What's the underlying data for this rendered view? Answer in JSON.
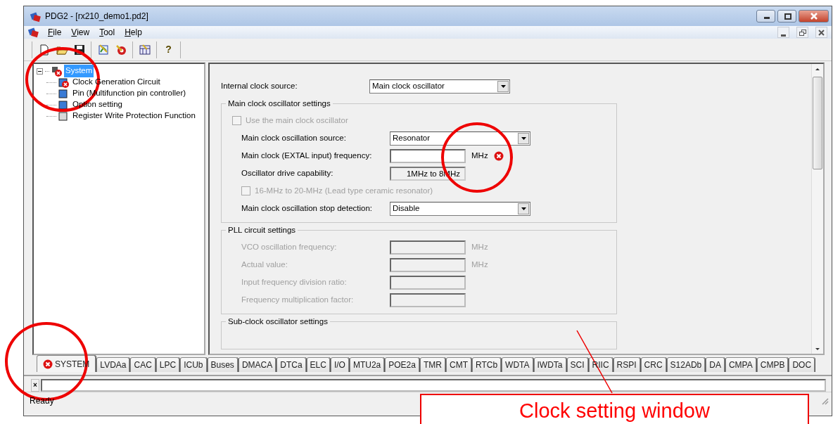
{
  "window": {
    "title": "PDG2 - [rx210_demo1.pd2]"
  },
  "menu": [
    {
      "label": "File"
    },
    {
      "label": "View"
    },
    {
      "label": "Tool"
    },
    {
      "label": "Help"
    }
  ],
  "toolbar": {
    "help_label": "?"
  },
  "tree": {
    "label": "System",
    "kind": "error",
    "selected": true,
    "expanded": true,
    "children": [
      {
        "label": "Clock Generation Circuit",
        "kind": "error",
        "selected": false
      },
      {
        "label": "Pin (Multifunction pin controller)",
        "kind": "ok",
        "selected": false
      },
      {
        "label": "Option setting",
        "kind": "ok",
        "selected": false
      },
      {
        "label": "Register Write Protection Function",
        "kind": "unused",
        "selected": false
      }
    ]
  },
  "form": {
    "internal_clock_source": {
      "label": "Internal clock source:",
      "value": "Main clock oscillator"
    },
    "groups": [
      {
        "title": "Main clock oscillator settings",
        "rows": [
          {
            "kind": "checkbox",
            "label": "Use the main clock oscillator",
            "checked": false,
            "disabled": true
          },
          {
            "kind": "select",
            "label": "Main clock oscillation source:",
            "value": "Resonator",
            "disabled": false
          },
          {
            "kind": "input",
            "label": "Main clock (EXTAL input) frequency:",
            "unit": "MHz",
            "error": true,
            "disabled": false
          },
          {
            "kind": "readout",
            "label": "Oscillator drive capability:",
            "value": "1MHz to 8MHz",
            "disabled": false
          },
          {
            "kind": "checkbox",
            "label": "16-MHz to 20-MHz (Lead type ceramic resonator)",
            "checked": false,
            "disabled": true
          },
          {
            "kind": "select",
            "label": "Main clock oscillation stop detection:",
            "value": "Disable",
            "disabled": false
          }
        ]
      },
      {
        "title": "PLL circuit settings",
        "rows": [
          {
            "kind": "input",
            "label": "VCO oscillation frequency:",
            "unit": "MHz",
            "error": false,
            "disabled": true
          },
          {
            "kind": "input",
            "label": "Actual value:",
            "unit": "MHz",
            "error": false,
            "disabled": true
          },
          {
            "kind": "input",
            "label": "Input frequency division ratio:",
            "error": false,
            "disabled": true
          },
          {
            "kind": "input",
            "label": "Frequency multiplication factor:",
            "error": false,
            "disabled": true
          }
        ]
      },
      {
        "title": "Sub-clock oscillator settings"
      }
    ]
  },
  "tabs": [
    {
      "label": "SYSTEM",
      "selected": true,
      "error": true
    },
    {
      "label": "LVDAa",
      "selected": false,
      "error": false
    },
    {
      "label": "CAC",
      "selected": false,
      "error": false
    },
    {
      "label": "LPC",
      "selected": false,
      "error": false
    },
    {
      "label": "ICUb",
      "selected": false,
      "error": false
    },
    {
      "label": "Buses",
      "selected": false,
      "error": false
    },
    {
      "label": "DMACA",
      "selected": false,
      "error": false
    },
    {
      "label": "DTCa",
      "selected": false,
      "error": false
    },
    {
      "label": "ELC",
      "selected": false,
      "error": false
    },
    {
      "label": "I/O",
      "selected": false,
      "error": false
    },
    {
      "label": "MTU2a",
      "selected": false,
      "error": false
    },
    {
      "label": "POE2a",
      "selected": false,
      "error": false
    },
    {
      "label": "TMR",
      "selected": false,
      "error": false
    },
    {
      "label": "CMT",
      "selected": false,
      "error": false
    },
    {
      "label": "RTCb",
      "selected": false,
      "error": false
    },
    {
      "label": "WDTA",
      "selected": false,
      "error": false
    },
    {
      "label": "IWDTa",
      "selected": false,
      "error": false
    },
    {
      "label": "SCI",
      "selected": false,
      "error": false
    },
    {
      "label": "RIIC",
      "selected": false,
      "error": false
    },
    {
      "label": "RSPI",
      "selected": false,
      "error": false
    },
    {
      "label": "CRC",
      "selected": false,
      "error": false
    },
    {
      "label": "S12ADb",
      "selected": false,
      "error": false
    },
    {
      "label": "DA",
      "selected": false,
      "error": false
    },
    {
      "label": "CMPA",
      "selected": false,
      "error": false
    },
    {
      "label": "CMPB",
      "selected": false,
      "error": false
    },
    {
      "label": "DOC",
      "selected": false,
      "error": false
    }
  ],
  "output_bar": {
    "close_label": "×"
  },
  "status_bar": {
    "text": "Ready"
  },
  "annotation": {
    "callout": "Clock setting window"
  }
}
